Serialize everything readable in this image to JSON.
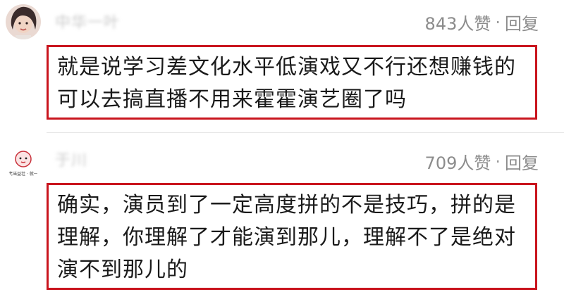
{
  "comments": [
    {
      "username": "中华一叶",
      "likes": "843人赞",
      "separator": "·",
      "reply_label": "回复",
      "text": "就是说学习差文化水平低演戏又不行还想赚钱的可以去搞直播不用来霍霍演艺圈了吗"
    },
    {
      "username": "于川",
      "avatar_text": "老当益壮 · 就一",
      "likes": "709人赞",
      "separator": "·",
      "reply_label": "回复",
      "text": "确实，演员到了一定高度拼的不是技巧，拼的是理解，你理解了才能演到那儿，理解不了是绝对演不到那儿的"
    }
  ],
  "colors": {
    "highlight_border": "#c9151e",
    "meta_text": "#8c8c8c",
    "body_text": "#1a1a1a"
  }
}
